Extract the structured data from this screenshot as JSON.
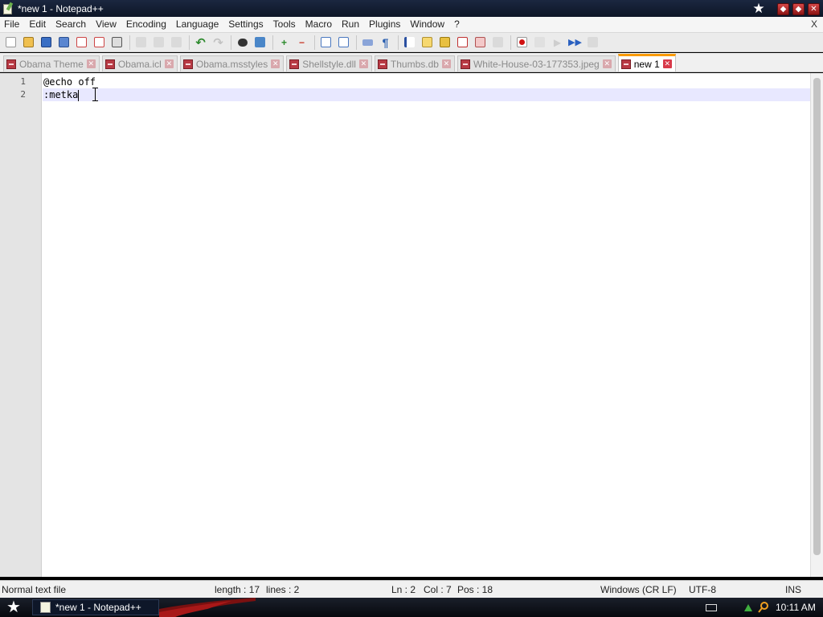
{
  "window": {
    "title": "*new 1 - Notepad++",
    "buttons": [
      "minimize",
      "maximize",
      "close"
    ]
  },
  "menu": {
    "items": [
      "File",
      "Edit",
      "Search",
      "View",
      "Encoding",
      "Language",
      "Settings",
      "Tools",
      "Macro",
      "Run",
      "Plugins",
      "Window",
      "?"
    ],
    "close": "X"
  },
  "toolbar": {
    "icons": [
      "new-file-icon",
      "open-file-icon",
      "save-icon",
      "save-all-icon",
      "close-icon",
      "close-all-icon",
      "print-icon",
      "cut-icon",
      "copy-icon",
      "paste-icon",
      "undo-icon",
      "redo-icon",
      "find-icon",
      "replace-icon",
      "zoom-in-icon",
      "zoom-out-icon",
      "sync-vertical-icon",
      "sync-horizontal-icon",
      "word-wrap-icon",
      "show-all-chars-icon",
      "indent-guide-icon",
      "user-language-icon",
      "document-map-icon",
      "function-list-icon",
      "folder-as-workspace-icon",
      "monitoring-icon",
      "record-macro-icon",
      "stop-recording-icon",
      "playback-macro-icon",
      "run-macro-multiple-icon",
      "save-macro-icon"
    ]
  },
  "tabs": [
    {
      "label": "Obama Theme",
      "active": false
    },
    {
      "label": "Obama.icl",
      "active": false
    },
    {
      "label": "Obama.msstyles",
      "active": false
    },
    {
      "label": "Shellstyle.dll",
      "active": false
    },
    {
      "label": "Thumbs.db",
      "active": false
    },
    {
      "label": "White-House-03-177353.jpeg",
      "active": false
    },
    {
      "label": "new 1",
      "active": true
    }
  ],
  "editor": {
    "lines": [
      {
        "number": "1",
        "text": "@echo off"
      },
      {
        "number": "2",
        "text": ":metka"
      }
    ],
    "current_line_color": "#e8e8ff",
    "gutter_color": "#e4e4e4"
  },
  "status": {
    "file_type": "Normal text file",
    "length": "length : 17",
    "lines": "lines : 2",
    "ln": "Ln : 2",
    "col": "Col : 7",
    "pos": "Pos : 18",
    "eol": "Windows (CR LF)",
    "encoding": "UTF-8",
    "mode": "INS"
  },
  "taskbar": {
    "task_label": "*new 1 - Notepad++",
    "clock": "10:11 AM"
  },
  "colors": {
    "tab_active_accent": "#fa9a00",
    "titlebar": "#0d1526",
    "close_button": "#d64848"
  }
}
